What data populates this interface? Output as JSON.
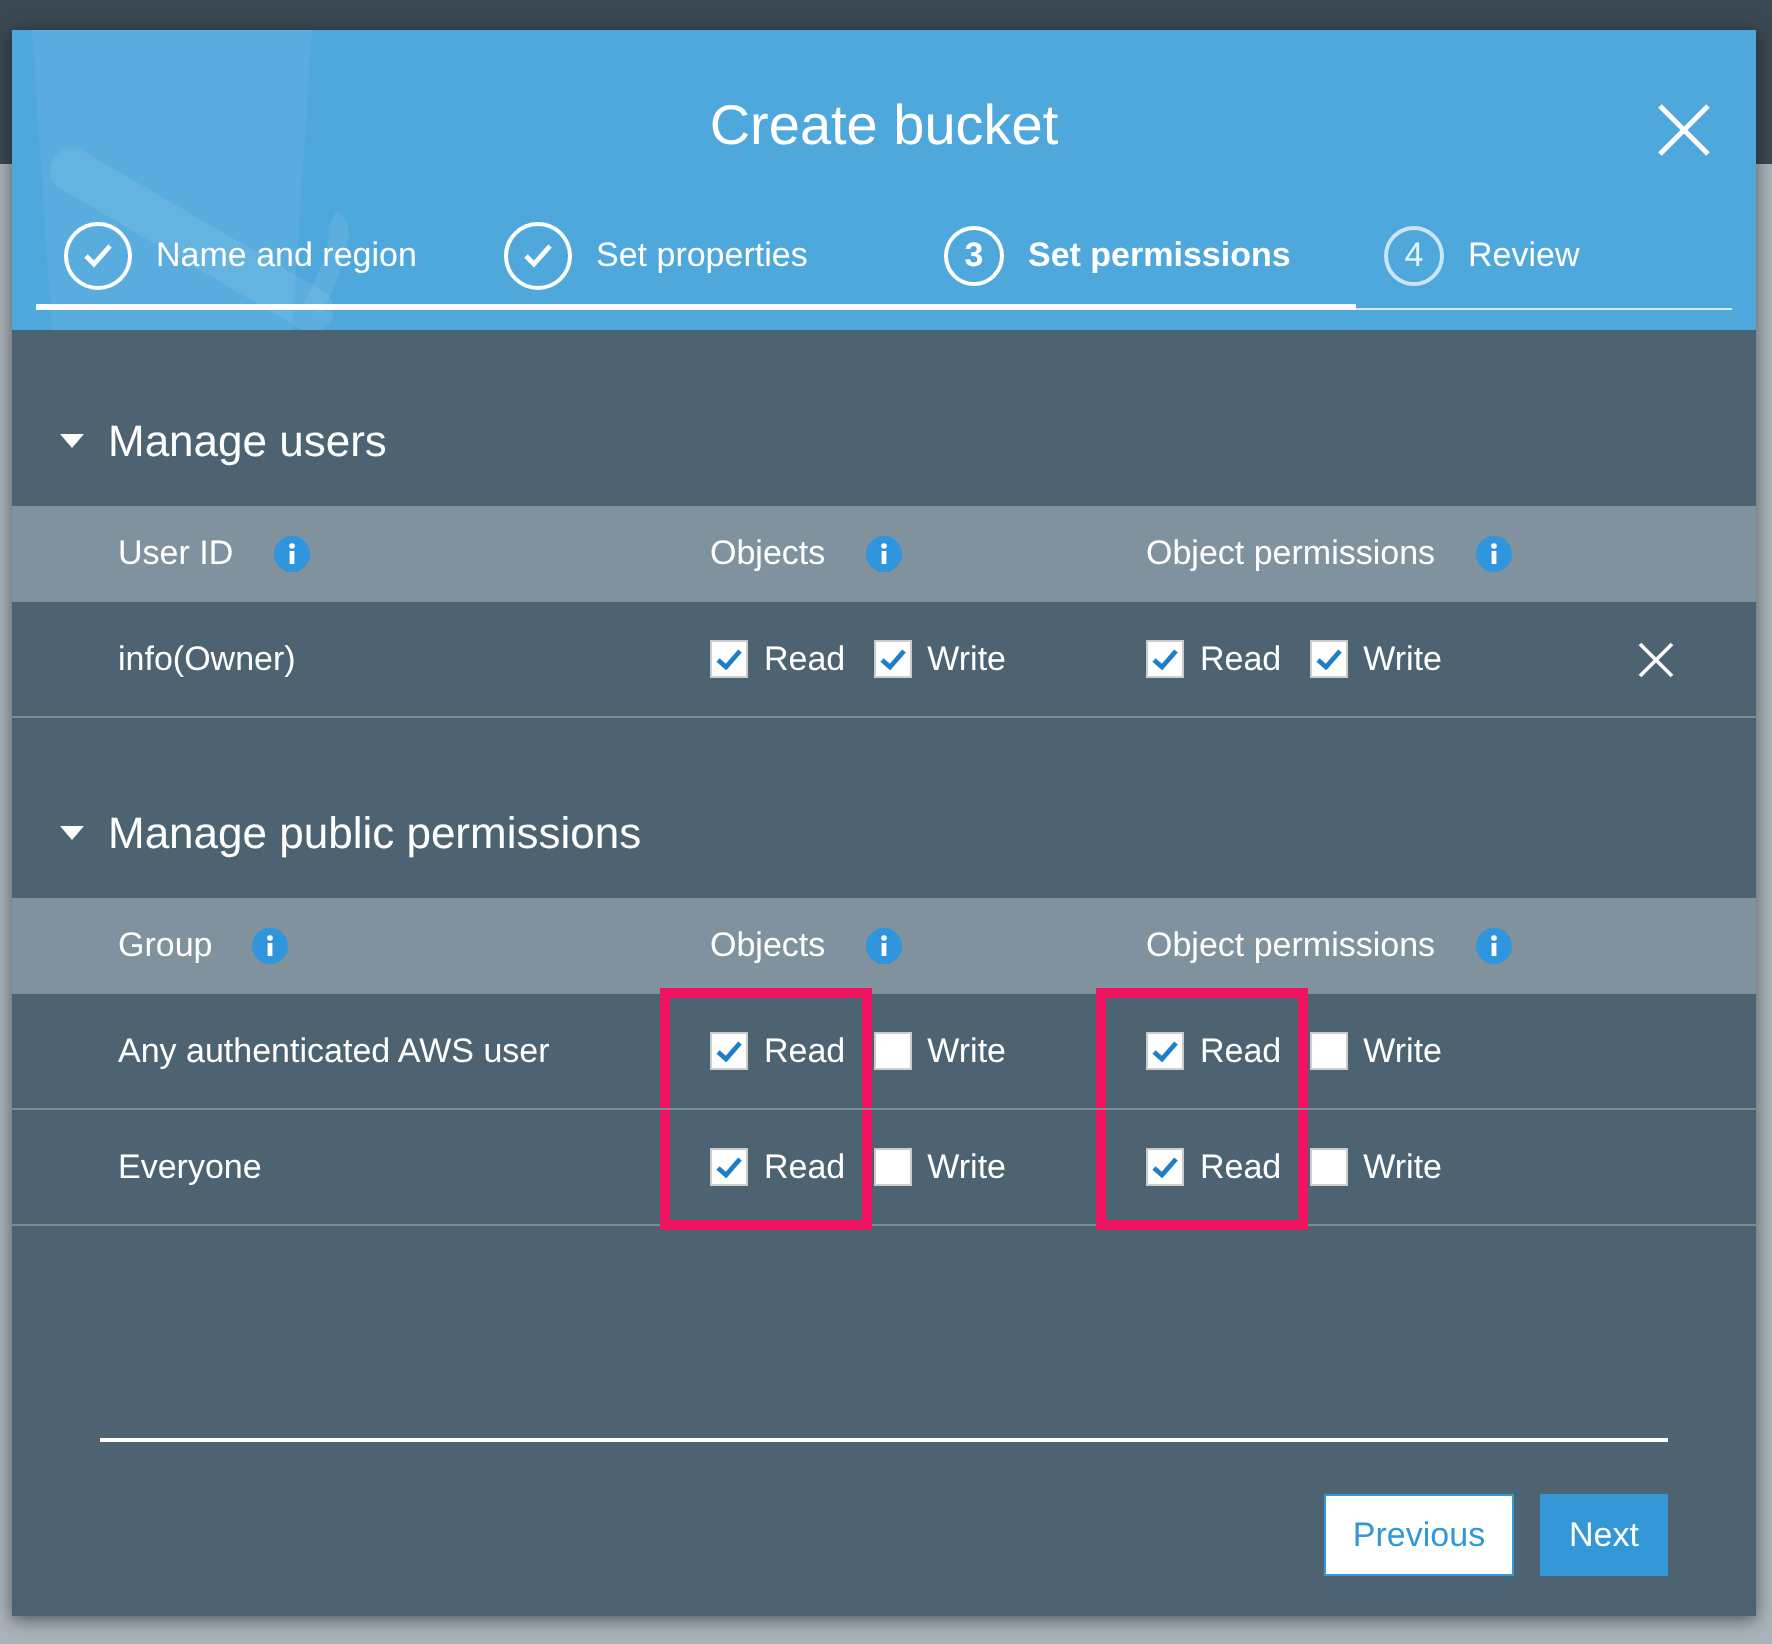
{
  "dialog": {
    "title": "Create bucket",
    "steps": [
      {
        "label": "Name and region",
        "completed": true,
        "selected": false
      },
      {
        "label": "Set properties",
        "completed": true,
        "selected": false
      },
      {
        "label": "Set permissions",
        "completed": false,
        "selected": true,
        "number": "3"
      },
      {
        "label": "Review",
        "completed": false,
        "selected": false,
        "number": "4"
      }
    ],
    "sections": [
      {
        "title": "Manage users",
        "expanded": true,
        "columns": [
          "User ID",
          "Objects",
          "Object permissions"
        ],
        "rows": [
          {
            "name": "info(Owner)",
            "removable": true,
            "objects": [
              {
                "label": "Read",
                "checked": true,
                "highlighted": false
              },
              {
                "label": "Write",
                "checked": true,
                "highlighted": false
              }
            ],
            "object_permissions": [
              {
                "label": "Read",
                "checked": true,
                "highlighted": false
              },
              {
                "label": "Write",
                "checked": true,
                "highlighted": false
              }
            ]
          }
        ]
      },
      {
        "title": "Manage public permissions",
        "expanded": true,
        "columns": [
          "Group",
          "Objects",
          "Object permissions"
        ],
        "rows": [
          {
            "name": "Any authenticated AWS user",
            "removable": false,
            "objects": [
              {
                "label": "Read",
                "checked": true,
                "highlighted": true
              },
              {
                "label": "Write",
                "checked": false,
                "highlighted": false
              }
            ],
            "object_permissions": [
              {
                "label": "Read",
                "checked": true,
                "highlighted": true
              },
              {
                "label": "Write",
                "checked": false,
                "highlighted": false
              }
            ]
          },
          {
            "name": "Everyone",
            "removable": false,
            "objects": [
              {
                "label": "Read",
                "checked": true,
                "highlighted": true
              },
              {
                "label": "Write",
                "checked": false,
                "highlighted": false
              }
            ],
            "object_permissions": [
              {
                "label": "Read",
                "checked": true,
                "highlighted": true
              },
              {
                "label": "Write",
                "checked": false,
                "highlighted": false
              }
            ]
          }
        ]
      }
    ],
    "buttons": [
      {
        "label": "Previous",
        "kind": "secondary"
      },
      {
        "label": "Next",
        "kind": "primary"
      }
    ]
  }
}
